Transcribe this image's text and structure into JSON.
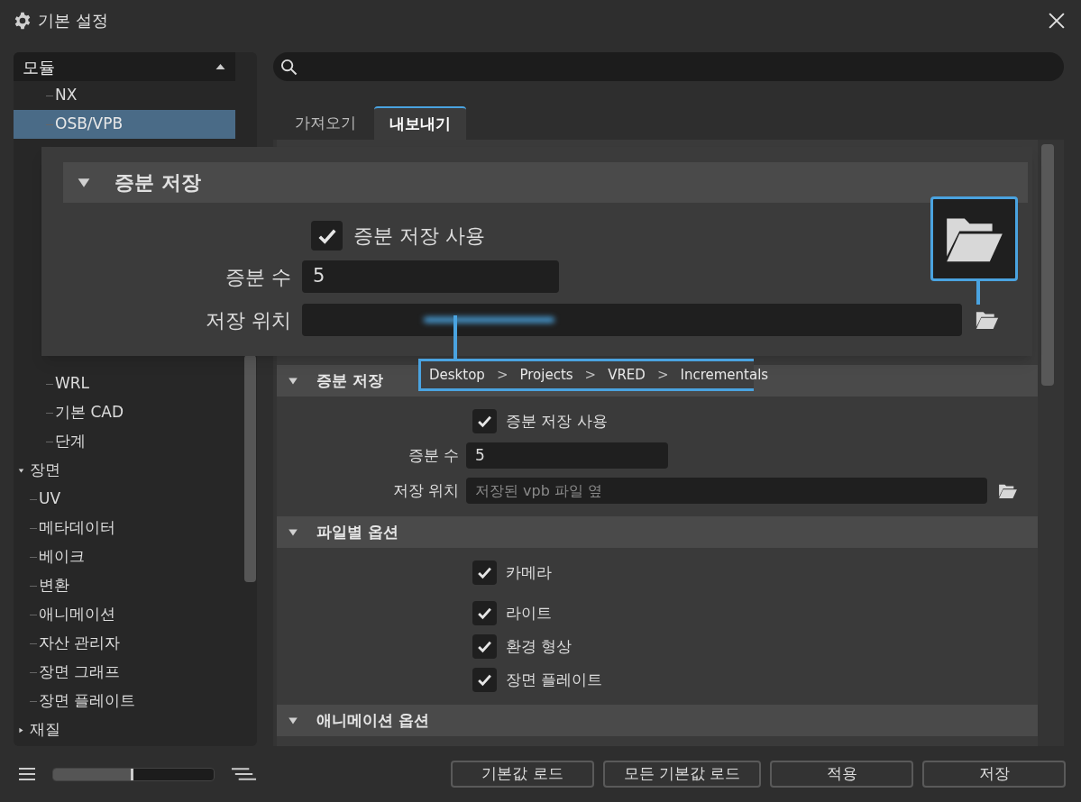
{
  "window": {
    "title": "기본 설정"
  },
  "sidebar": {
    "header": {
      "label": "모듈",
      "expanded": true
    },
    "tree": [
      {
        "label": "NX",
        "selected": false
      },
      {
        "label": "OSB/VPB",
        "selected": true
      },
      {
        "label": "WRL",
        "selected": false
      },
      {
        "label": "기본 CAD",
        "selected": false
      },
      {
        "label": "단계",
        "selected": false
      },
      {
        "label": "장면",
        "selected": false,
        "expanded": true,
        "children": [
          {
            "label": "UV",
            "selected": false
          },
          {
            "label": "메타데이터",
            "selected": false
          },
          {
            "label": "베이크",
            "selected": false
          },
          {
            "label": "변환",
            "selected": false
          },
          {
            "label": "애니메이션",
            "selected": false
          },
          {
            "label": "자산 관리자",
            "selected": false
          },
          {
            "label": "장면 그래프",
            "selected": false
          },
          {
            "label": "장면 플레이트",
            "selected": false
          }
        ]
      },
      {
        "label": "재질",
        "selected": false,
        "expanded": false
      }
    ],
    "zoom": {
      "level": 0.5
    }
  },
  "tabs": [
    {
      "label": "가져오기",
      "selected": false
    },
    {
      "label": "내보내기",
      "selected": true
    }
  ],
  "sections": [
    {
      "title": "증분 저장",
      "expanded": true,
      "rows": [
        {
          "kind": "checkbox",
          "label": "증분 저장 사용",
          "checked": true
        },
        {
          "kind": "number",
          "label": "증분 수",
          "value": "5"
        },
        {
          "kind": "path",
          "label": "저장 위치",
          "placeholder": "저장된 vpb 파일 옆"
        }
      ]
    },
    {
      "title": "파일별 옵션",
      "expanded": true,
      "rows": [
        {
          "kind": "checkbox",
          "label": "카메라",
          "checked": true
        },
        {
          "kind": "checkbox",
          "label": "라이트",
          "checked": true
        },
        {
          "kind": "checkbox",
          "label": "환경 형상",
          "checked": true
        },
        {
          "kind": "checkbox",
          "label": "장면 플레이트",
          "checked": true
        }
      ]
    },
    {
      "title": "애니메이션 옵션",
      "expanded": true
    }
  ],
  "callout": {
    "title": "증분 저장",
    "expanded": true,
    "use_label": "증분 저장 사용",
    "use_checked": true,
    "count_label": "증분 수",
    "count_value": "5",
    "location_label": "저장 위치",
    "breadcrumb": [
      {
        "kind": "crumb",
        "text": "Desktop"
      },
      {
        "kind": "separator",
        "text": ">"
      },
      {
        "kind": "crumb",
        "text": "Projects"
      },
      {
        "kind": "separator",
        "text": ">"
      },
      {
        "kind": "crumb",
        "text": "VRED"
      },
      {
        "kind": "separator",
        "text": ">"
      },
      {
        "kind": "crumb",
        "text": "Incrementals"
      }
    ]
  },
  "buttons": [
    "기본값 로드",
    "모든 기본값 로드",
    "적용",
    "저장"
  ]
}
